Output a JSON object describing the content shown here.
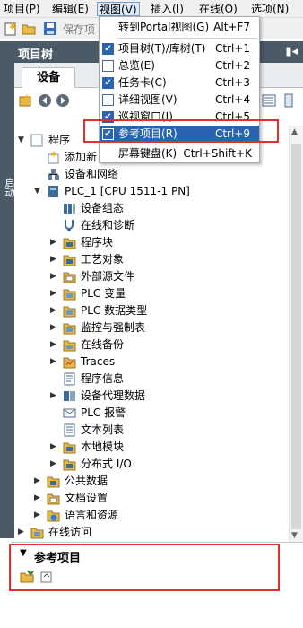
{
  "menubar": {
    "items": [
      "项目(P)",
      "编辑(E)",
      "视图(V)",
      "插入(I)",
      "在线(O)",
      "选项(N)"
    ]
  },
  "toolbar": {
    "save_label": "保存项"
  },
  "view_menu": {
    "items": [
      {
        "label": "转到Portal视图(G)",
        "shortcut": "Alt+F7",
        "checked": null
      },
      {
        "label": "项目树(T)/库树(T)",
        "shortcut": "Ctrl+1",
        "checked": true
      },
      {
        "label": "总览(E)",
        "shortcut": "Ctrl+2",
        "checked": false
      },
      {
        "label": "任务卡(C)",
        "shortcut": "Ctrl+3",
        "checked": true
      },
      {
        "label": "详细视图(V)",
        "shortcut": "Ctrl+4",
        "checked": false
      },
      {
        "label": "巡视窗口(I)",
        "shortcut": "Ctrl+5",
        "checked": true
      },
      {
        "label": "参考项目(R)",
        "shortcut": "Ctrl+9",
        "checked": true
      },
      {
        "label": "屏幕键盘(K)",
        "shortcut": "Ctrl+Shift+K",
        "checked": null
      }
    ]
  },
  "project_tree": {
    "title": "项目树",
    "side_label": "启动",
    "tab_label": "设备",
    "rows": [
      {
        "label": "程序"
      },
      {
        "label": "添加新"
      },
      {
        "label": "设备和网络"
      },
      {
        "label": "PLC_1 [CPU 1511-1 PN]"
      },
      {
        "label": "设备组态"
      },
      {
        "label": "在线和诊断"
      },
      {
        "label": "程序块"
      },
      {
        "label": "工艺对象"
      },
      {
        "label": "外部源文件"
      },
      {
        "label": "PLC 变量"
      },
      {
        "label": "PLC 数据类型"
      },
      {
        "label": "监控与强制表"
      },
      {
        "label": "在线备份"
      },
      {
        "label": "Traces"
      },
      {
        "label": "程序信息"
      },
      {
        "label": "设备代理数据"
      },
      {
        "label": "PLC 报警"
      },
      {
        "label": "文本列表"
      },
      {
        "label": "本地模块"
      },
      {
        "label": "分布式 I/O"
      },
      {
        "label": "公共数据"
      },
      {
        "label": "文档设置"
      },
      {
        "label": "语言和资源"
      },
      {
        "label": "在线访问"
      }
    ]
  },
  "reference_panel": {
    "title": "参考项目"
  },
  "colors": {
    "header_bg": "#4b5a67",
    "highlight": "#2a64b0",
    "annotation_red": "#e03030"
  }
}
